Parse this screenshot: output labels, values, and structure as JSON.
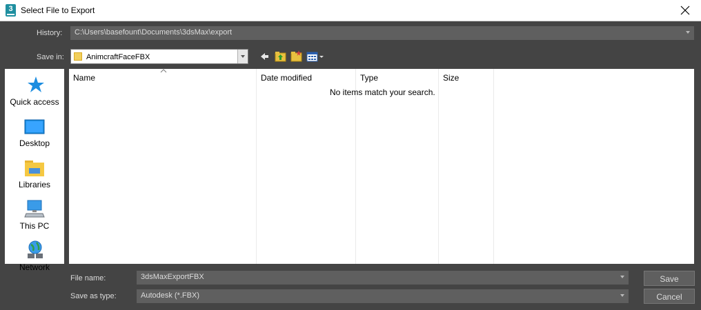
{
  "window": {
    "title": "Select File to Export",
    "app_icon_text": "3"
  },
  "dialog": {
    "history_label": "History:",
    "history_value": "C:\\Users\\basefount\\Documents\\3dsMax\\export",
    "save_in_label": "Save in:",
    "save_in_value": "AnimcraftFaceFBX",
    "toolbar": [
      "back-arrow-icon",
      "up-folder-icon",
      "new-folder-icon",
      "view-menu-icon"
    ]
  },
  "places": [
    {
      "label": "Quick access",
      "icon": "star-icon"
    },
    {
      "label": "Desktop",
      "icon": "desktop-icon"
    },
    {
      "label": "Libraries",
      "icon": "libraries-icon"
    },
    {
      "label": "This PC",
      "icon": "computer-icon"
    },
    {
      "label": "Network",
      "icon": "network-icon"
    }
  ],
  "filelist": {
    "columns": [
      "Name",
      "Date modified",
      "Type",
      "Size"
    ],
    "empty_message": "No items match your search."
  },
  "footer": {
    "file_name_label": "File name:",
    "file_name_value": "3dsMaxExportFBX",
    "save_type_label": "Save as type:",
    "save_type_value": "Autodesk (*.FBX)",
    "save_button": "Save",
    "cancel_button": "Cancel"
  },
  "colors": {
    "background": "#444444",
    "field": "#5f5f5f",
    "accent": "#1f8fa0"
  }
}
